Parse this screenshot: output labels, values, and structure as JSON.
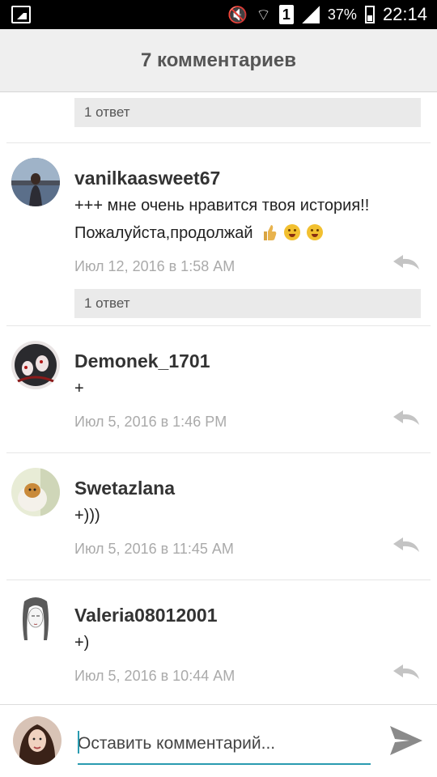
{
  "status_bar": {
    "battery": "37%",
    "time": "22:14",
    "sim_label": "1"
  },
  "header": {
    "title": "7 комментариев"
  },
  "top_partial": {
    "reply_count": "1 ответ"
  },
  "comments": [
    {
      "user": "vanilkaasweet67",
      "text_line1": "+++ мне очень нравится твоя история!!",
      "text_line2": "Пожалуйста,продолжай",
      "date": "Июл 12, 2016 в 1:58 AM",
      "reply_count": "1 ответ"
    },
    {
      "user": "Demonek_1701",
      "text": "+",
      "date": "Июл 5, 2016 в 1:46 PM"
    },
    {
      "user": "Swetazlana",
      "text": "+)))",
      "date": "Июл 5, 2016 в 11:45 AM"
    },
    {
      "user": "Valeria08012001",
      "text": "+)",
      "date": "Июл 5, 2016 в 10:44 AM"
    }
  ],
  "input": {
    "placeholder": "Оставить комментарий..."
  },
  "colors": {
    "accent": "#2a9bb0",
    "header_bg": "#efefef",
    "status_bar_bg": "#000000"
  },
  "icons": {
    "reply": "reply-arrow-icon",
    "send": "send-icon"
  }
}
